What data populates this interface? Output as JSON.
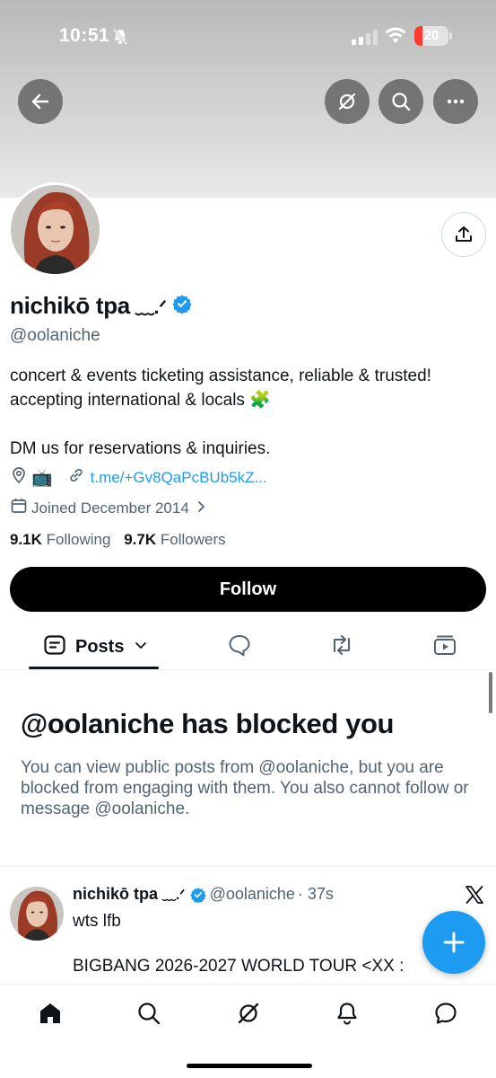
{
  "status_bar": {
    "time": "10:51",
    "battery": "20"
  },
  "top_bar": {
    "back_icon": "arrow-left-icon",
    "grok_icon": "slashed-circle-icon",
    "search_icon": "search-icon",
    "more_icon": "more-horizontal-icon"
  },
  "profile": {
    "name": "nichikō tpa",
    "name_suffix": "﹏.ᐟ",
    "handle": "@oolaniche",
    "bio_line1": "concert & events ticketing assistance, reliable & trusted!",
    "bio_line2": "accepting international & locals 🧩",
    "bio_line3": "DM us for reservations & inquiries.",
    "location_emoji": "📺",
    "link": "t.me/+Gv8QaPcBUb5kZ...",
    "joined": "Joined December 2014",
    "following_count": "9.1K",
    "following_label": "Following",
    "followers_count": "9.7K",
    "followers_label": "Followers"
  },
  "follow_button": "Follow",
  "tabs": {
    "posts_label": "Posts"
  },
  "blocked": {
    "title": "@oolaniche has blocked you",
    "message": "You can view public posts from @oolaniche, but you are blocked from engaging with them. You also cannot follow or message @oolaniche."
  },
  "post": {
    "name": "nichikō tpa",
    "name_suffix": "﹏.ᐟ",
    "handle": "@oolaniche",
    "time": "· 37s",
    "text1": "wts lfb",
    "text2": "BIGBANG 2026-2027 WORLD TOUR <XX :"
  },
  "colors": {
    "accent": "#1d9bf0",
    "text": "#0f1419",
    "secondary": "#536471",
    "button": "#000000"
  }
}
